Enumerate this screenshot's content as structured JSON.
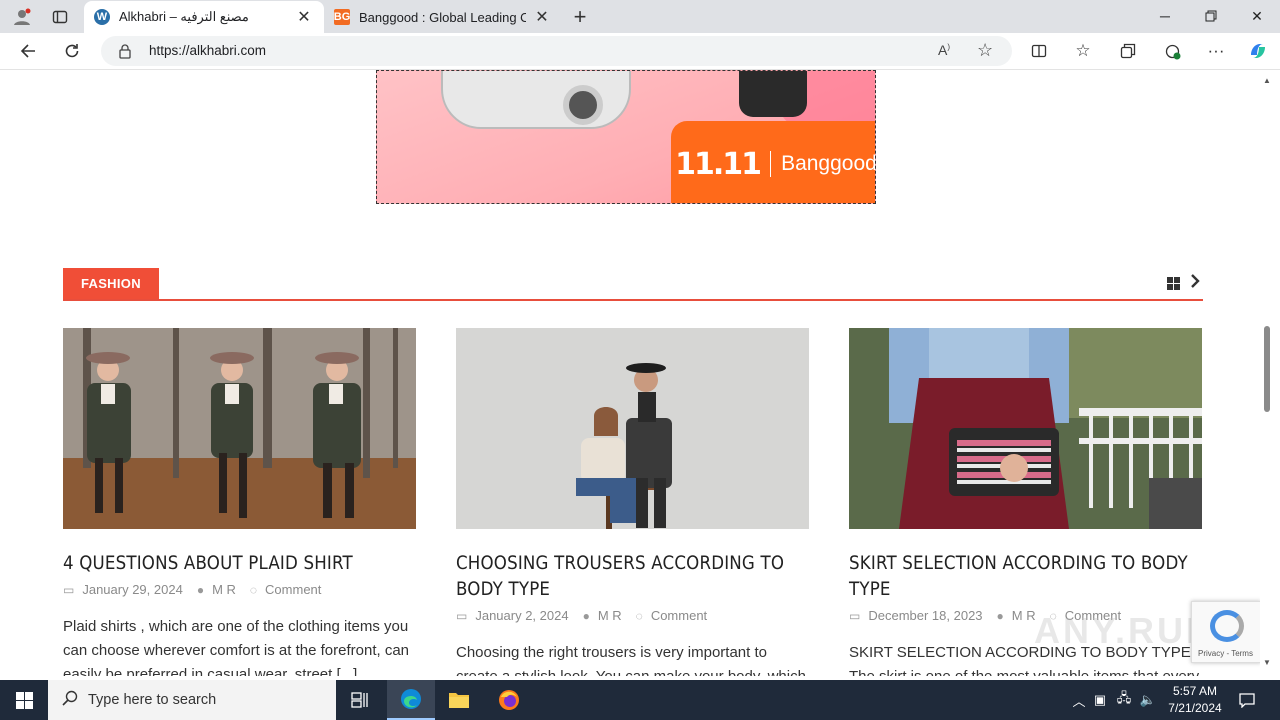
{
  "browser": {
    "tabs": [
      {
        "title": "Alkhabri – مصنع الترفيه",
        "favicon": "wordpress-icon"
      },
      {
        "title": "Banggood : Global Leading Onlin",
        "favicon": "banggood-icon",
        "favicon_text": "BG"
      }
    ],
    "url": "https://alkhabri.com"
  },
  "ad": {
    "sale_number": "11.11",
    "brand": "Banggood",
    "brand_color": "#ff6a1a"
  },
  "section": {
    "label": "FASHION",
    "accent": "#f04e37"
  },
  "posts": [
    {
      "title": "4 QUESTIONS ABOUT PLAID SHIRT",
      "date": "January 29, 2024",
      "author": "M R",
      "comment": "Comment",
      "excerpt": "Plaid shirts , which are one of the clothing items you can choose wherever comfort is at the forefront, can easily be preferred in casual wear, street [...]"
    },
    {
      "title": "CHOOSING TROUSERS ACCORDING TO BODY TYPE",
      "date": "January 2, 2024",
      "author": "M R",
      "comment": "Comment",
      "excerpt": "Choosing the right trousers is very important to create a stylish look. You can make your body, which"
    },
    {
      "title": "SKIRT SELECTION ACCORDING TO BODY TYPE",
      "date": "December 18, 2023",
      "author": "M R",
      "comment": "Comment",
      "excerpt": "SKIRT SELECTION ACCORDING TO BODY TYPE  The skirt is one of the most valuable items that every"
    }
  ],
  "recaptcha": {
    "text": "Privacy - Terms"
  },
  "watermark": "ANY.RUN",
  "taskbar": {
    "search_placeholder": "Type here to search",
    "time": "5:57 AM",
    "date": "7/21/2024"
  }
}
